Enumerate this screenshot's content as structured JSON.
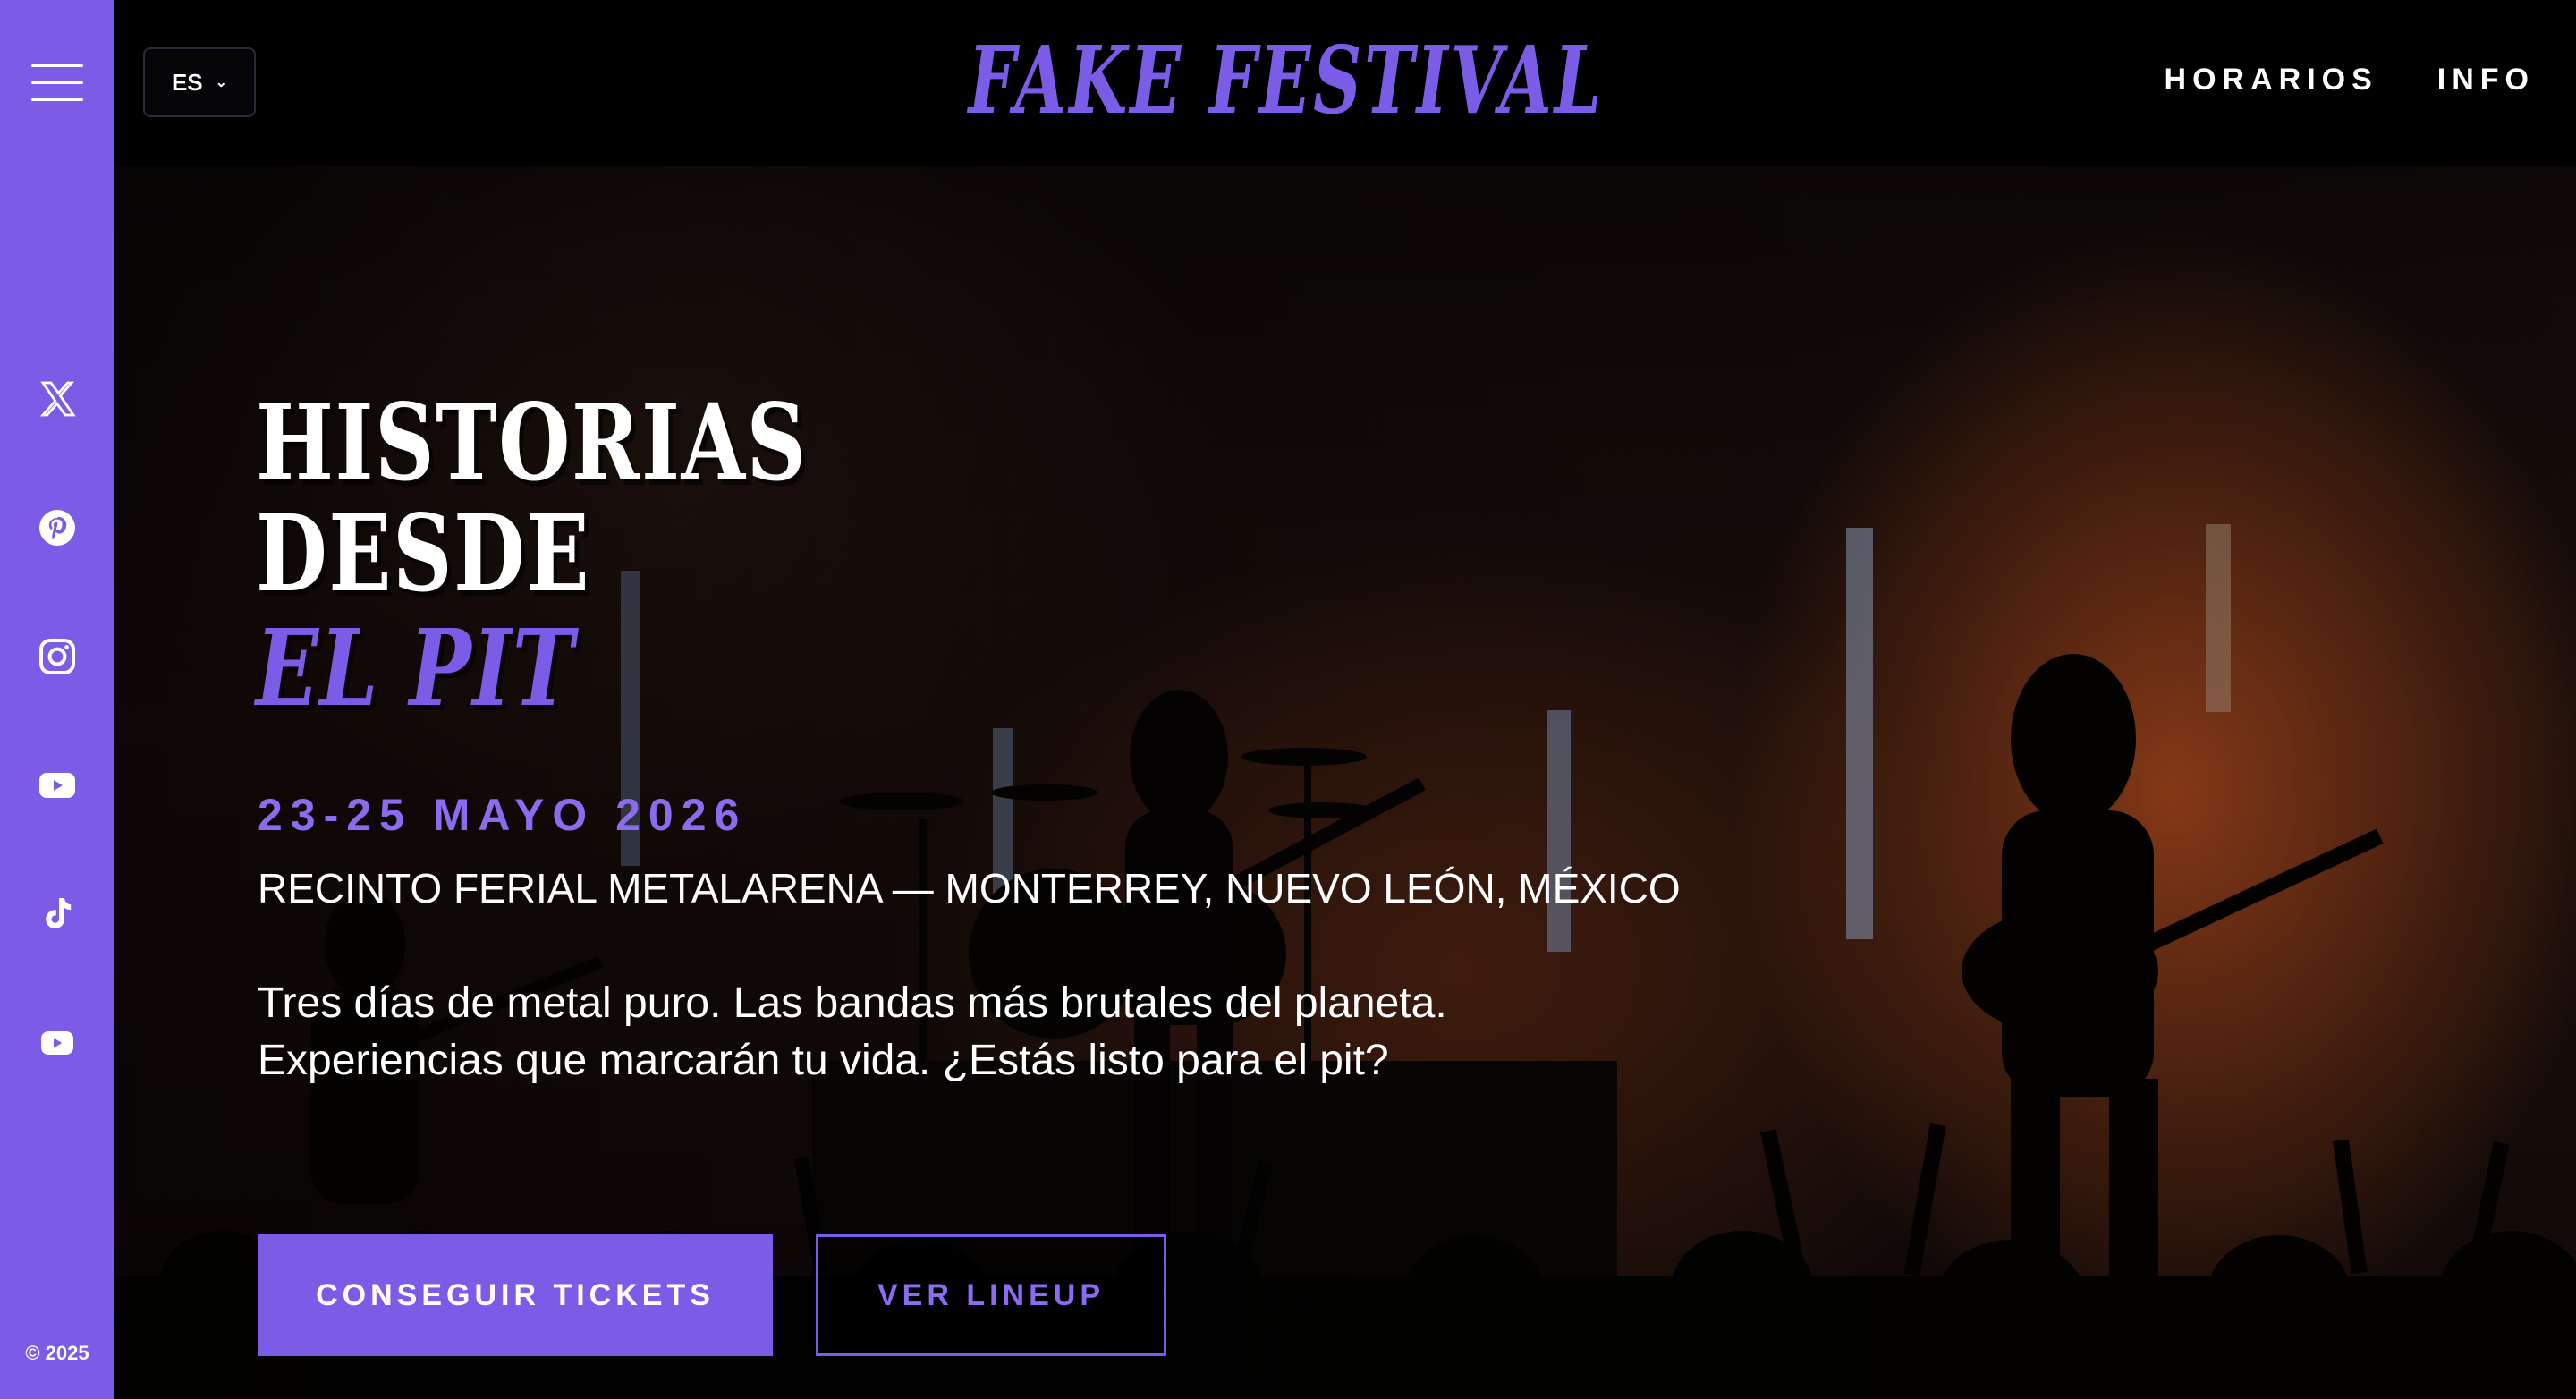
{
  "header": {
    "language": "ES",
    "logo": "FAKE FESTIVAL",
    "nav": [
      "HORARIOS",
      "INFO"
    ]
  },
  "sidebar": {
    "social": [
      "x-icon",
      "pinterest-icon",
      "instagram-icon",
      "youtube-icon",
      "tiktok-icon",
      "youtube-icon"
    ],
    "copyright": "© 2025"
  },
  "hero": {
    "title_line1": "HISTORIAS",
    "title_line2": "DESDE",
    "title_line3": "EL PIT",
    "dates": "23-25 MAYO 2026",
    "venue": "RECINTO FERIAL METALARENA — MONTERREY, NUEVO LEÓN, MÉXICO",
    "description": "Tres días de metal puro. Las bandas más brutales del planeta. Experiencias que marcarán tu vida. ¿Estás listo para el pit?",
    "cta_primary": "CONSEGUIR TICKETS",
    "cta_secondary": "VER LINEUP"
  },
  "colors": {
    "accent": "#7b5ce6",
    "background": "#000000",
    "text": "#ffffff"
  }
}
